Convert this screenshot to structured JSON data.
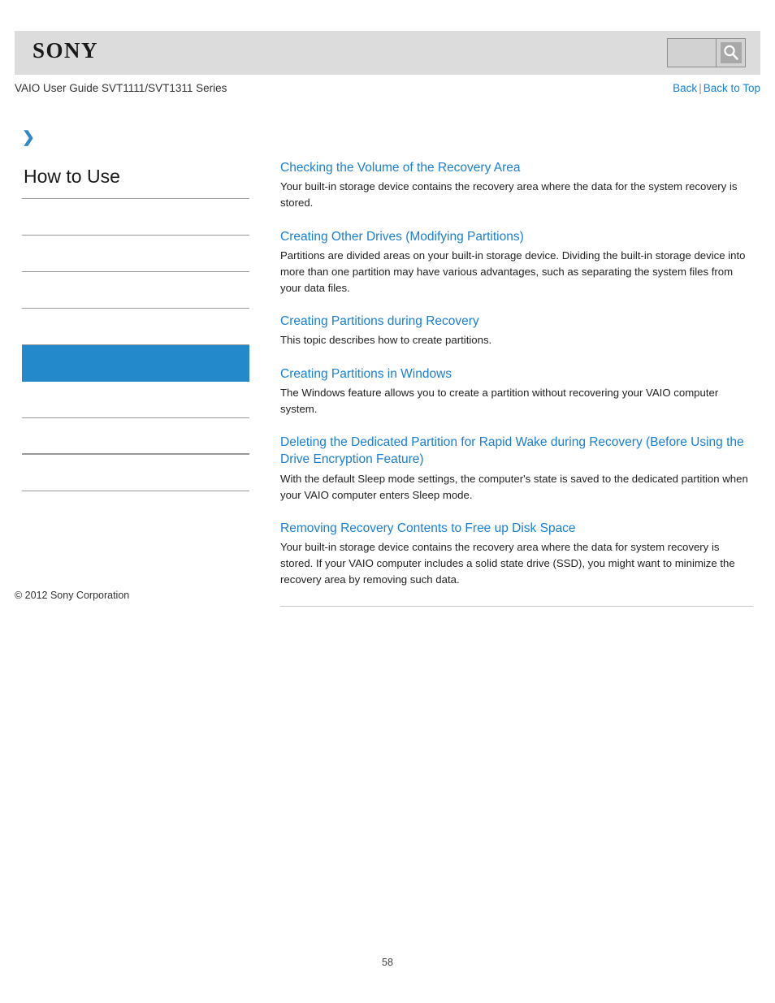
{
  "header": {
    "logo_text": "SONY",
    "logo_icon": "sony-wordmark",
    "search": {
      "value": "",
      "placeholder": "",
      "button_icon": "search-icon"
    }
  },
  "titlebar": {
    "guide_title": "VAIO User Guide SVT1111/SVT1311 Series",
    "nav": {
      "back_label": "Back",
      "separator": "|",
      "back_to_top_label": "Back to Top"
    }
  },
  "sidebar": {
    "breadcrumb_icon": "chevron-right-icon",
    "breadcrumb_glyph": "❯",
    "heading": "How to Use",
    "items": [
      {
        "label": "",
        "active": false,
        "thick": false
      },
      {
        "label": "",
        "active": false,
        "thick": false
      },
      {
        "label": "",
        "active": false,
        "thick": false
      },
      {
        "label": "",
        "active": false,
        "thick": false
      },
      {
        "label": "",
        "active": true,
        "thick": false
      },
      {
        "label": "",
        "active": false,
        "thick": false
      },
      {
        "label": "",
        "active": false,
        "thick": true
      },
      {
        "label": "",
        "active": false,
        "thick": false
      }
    ]
  },
  "content": {
    "topics": [
      {
        "title": "Checking the Volume of the Recovery Area",
        "description": "Your built-in storage device contains the recovery area where the data for the system recovery is stored."
      },
      {
        "title": "Creating Other Drives (Modifying Partitions)",
        "description": "Partitions are divided areas on your built-in storage device. Dividing the built-in storage device into more than one partition may have various advantages, such as separating the system files from your data files."
      },
      {
        "title": "Creating Partitions during Recovery",
        "description": "This topic describes how to create partitions."
      },
      {
        "title": "Creating Partitions in Windows",
        "description": "The Windows feature allows you to create a partition without recovering your VAIO computer system."
      },
      {
        "title": "Deleting the Dedicated Partition for Rapid Wake during Recovery (Before Using the Drive Encryption Feature)",
        "description": "With the default Sleep mode settings, the computer's state is saved to the dedicated partition when your VAIO computer enters Sleep mode."
      },
      {
        "title": "Removing Recovery Contents to Free up Disk Space",
        "description": "Your built-in storage device contains the recovery area where the data for system recovery is stored. If your VAIO computer includes a solid state drive (SSD), you might want to minimize the recovery area by removing such data."
      }
    ]
  },
  "footer": {
    "copyright": "© 2012 Sony Corporation",
    "page_number": "58"
  },
  "colors": {
    "accent_blue": "#1a7fd4",
    "highlight_blue": "#2489ca",
    "header_gray": "#dcdcdc",
    "rule_gray": "#999999"
  }
}
